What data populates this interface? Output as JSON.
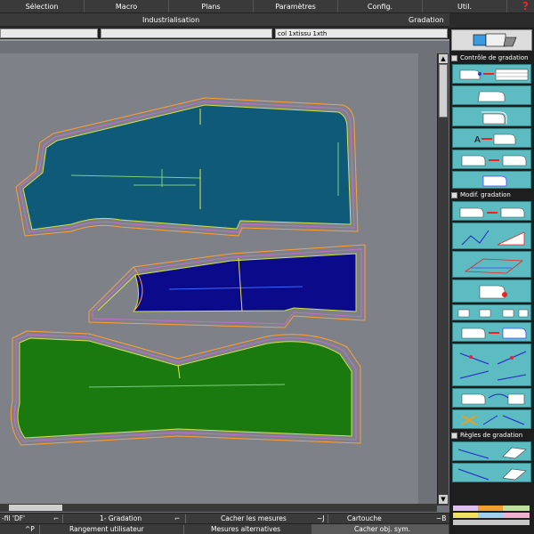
{
  "menu": [
    "Sélection",
    "Macro",
    "Plans",
    "Paramètres",
    "Config.",
    "Util."
  ],
  "help_symbol": "?",
  "modes": {
    "left": "Industrialisation",
    "right": "Gradation"
  },
  "fields": {
    "main_value": "col 1xtissu 1xth"
  },
  "panel": {
    "section1": "Contrôle de gradation",
    "section2": "Modif. gradation",
    "section3": "Règles de gradation"
  },
  "status_row1": {
    "left": "-fil 'DF'",
    "shortcut_left": "⌐",
    "grading": "1- Gradation",
    "grading_key": "⌐",
    "hide_measures": "Cacher les mesures",
    "hide_key": "~J",
    "cartouche": "Cartouche",
    "cartouche_key": "~B"
  },
  "status_row2": {
    "key1": "^P",
    "user_layout": "Rangement utilisateur",
    "alt_measures": "Mesures alternatives",
    "hide_sym": "Cacher obj. sym."
  },
  "colors": {
    "piece_top": "#0e5a78",
    "piece_mid": "#0a0a8a",
    "piece_bottom": "#1a7a10",
    "tool_bg": "#5cbcc1",
    "canvas": "#7f8189"
  }
}
